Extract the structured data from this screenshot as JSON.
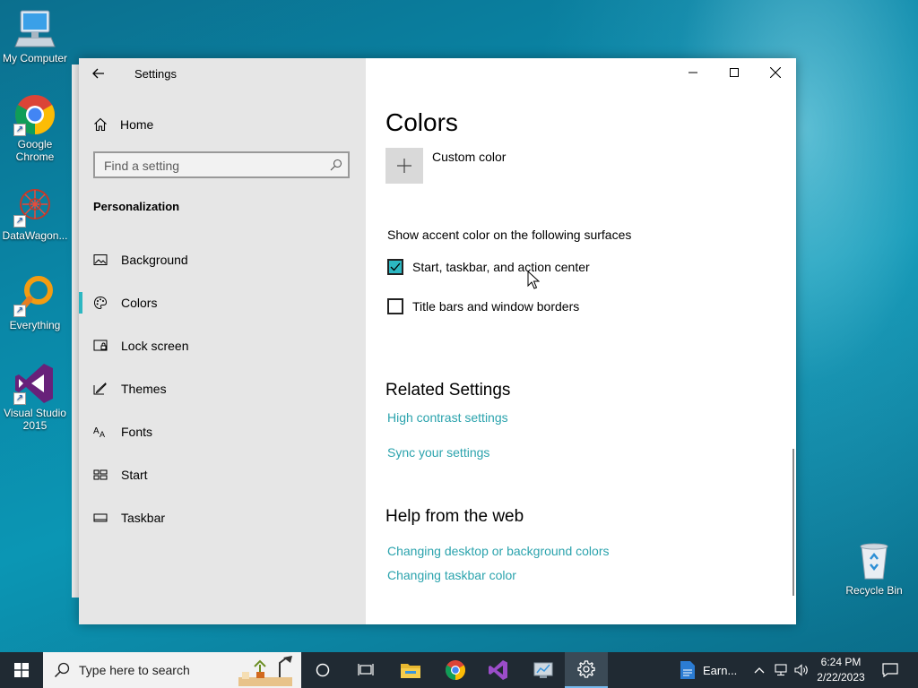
{
  "desktop": {
    "icons": [
      {
        "label": "My Computer"
      },
      {
        "label": "Google Chrome"
      },
      {
        "label": "DataWagon..."
      },
      {
        "label": "Everything"
      },
      {
        "label": "Visual Studio 2015"
      },
      {
        "label": "Recycle Bin"
      }
    ]
  },
  "window": {
    "title": "Settings",
    "controls": {
      "minimize": "—",
      "maximize": "☐",
      "close": "✕"
    }
  },
  "sidebar": {
    "home_label": "Home",
    "search_placeholder": "Find a setting",
    "section_heading": "Personalization",
    "items": [
      {
        "label": "Background",
        "icon": "picture-icon"
      },
      {
        "label": "Colors",
        "icon": "palette-icon",
        "active": true
      },
      {
        "label": "Lock screen",
        "icon": "lock-screen-icon"
      },
      {
        "label": "Themes",
        "icon": "themes-icon"
      },
      {
        "label": "Fonts",
        "icon": "fonts-icon"
      },
      {
        "label": "Start",
        "icon": "start-icon"
      },
      {
        "label": "Taskbar",
        "icon": "taskbar-icon"
      }
    ]
  },
  "main": {
    "title": "Colors",
    "custom_color_label": "Custom color",
    "surfaces_label": "Show accent color on the following surfaces",
    "checkboxes": [
      {
        "label": "Start, taskbar, and action center",
        "checked": true
      },
      {
        "label": "Title bars and window borders",
        "checked": false
      }
    ],
    "related_heading": "Related Settings",
    "related_links": [
      "High contrast settings",
      "Sync your settings"
    ],
    "help_heading": "Help from the web",
    "help_links": [
      "Changing desktop or background colors",
      "Changing taskbar color"
    ]
  },
  "taskbar": {
    "search_placeholder": "Type here to search",
    "running_app_label": "Earn...",
    "clock_time": "6:24 PM",
    "clock_date": "2/22/2023"
  },
  "colors": {
    "accent": "#2cb7c2",
    "link": "#2ba3ad",
    "taskbar": "#202a33"
  }
}
